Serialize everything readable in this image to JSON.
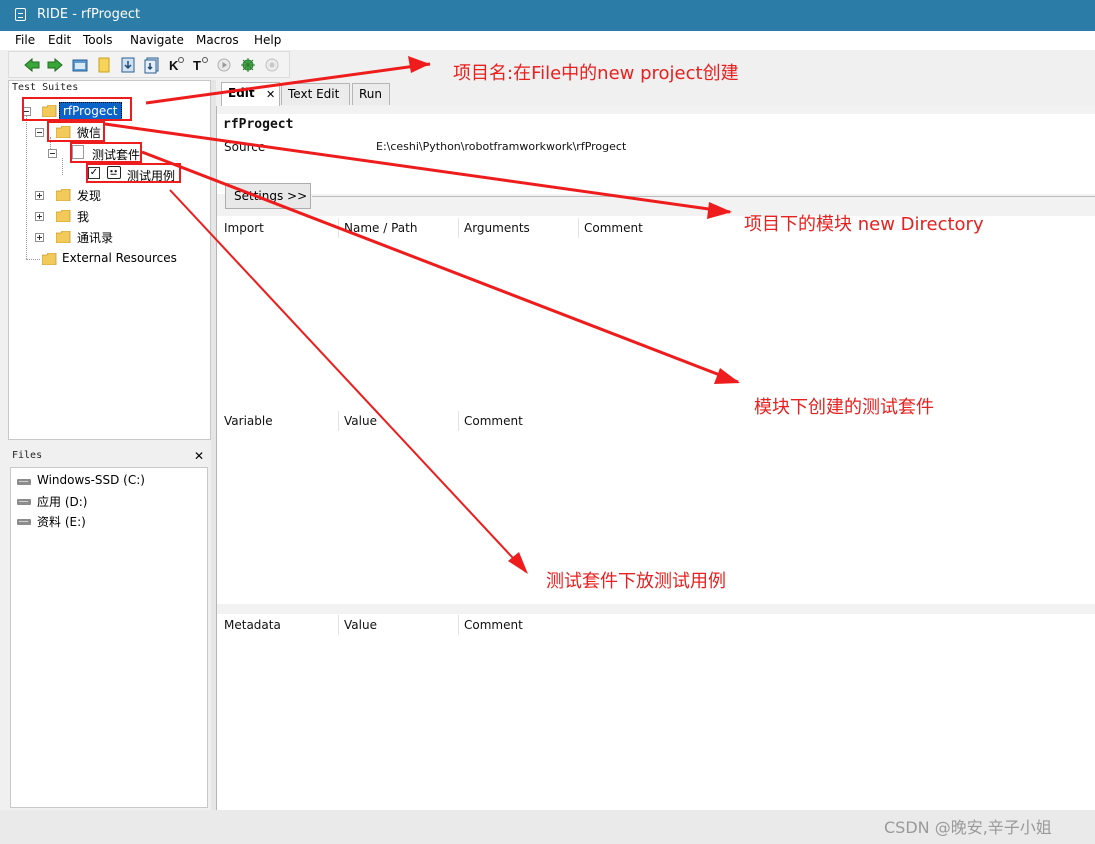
{
  "window": {
    "title": "RIDE - rfProgect"
  },
  "menu": {
    "items": [
      {
        "label": "File"
      },
      {
        "label": "Edit"
      },
      {
        "label": "Tools"
      },
      {
        "label": "Navigate"
      },
      {
        "label": "Macros"
      },
      {
        "label": "Help"
      }
    ]
  },
  "toolbar": {
    "icons": [
      "back-arrow-icon",
      "forward-arrow-icon",
      "open-folder-icon",
      "new-folder-icon",
      "save-icon",
      "save-all-icon",
      "keyword-search-icon",
      "text-search-icon",
      "run-icon",
      "debug-icon",
      "stop-icon"
    ]
  },
  "tree": {
    "panel_label": "Test Suites",
    "project": "rfProgect",
    "directory": "微信",
    "suite": "测试套件",
    "testcase": "测试用例",
    "others": [
      "发现",
      "我",
      "通讯录"
    ],
    "external": "External Resources"
  },
  "files": {
    "panel_label": "Files",
    "close_glyph": "✕",
    "drives": [
      "Windows-SSD (C:)",
      "应用 (D:)",
      "资料 (E:)"
    ]
  },
  "tabs": [
    {
      "label": "Edit",
      "close_glyph": "✕",
      "active": true
    },
    {
      "label": "Text Edit",
      "active": false
    },
    {
      "label": "Run",
      "active": false
    }
  ],
  "editor": {
    "name": "rfProgect",
    "source_label": "Source",
    "source_value": "E:\\ceshi\\Python\\robotframworkwork\\rfProgect",
    "settings_button": "Settings >>",
    "import_headers": [
      "Import",
      "Name / Path",
      "Arguments",
      "Comment"
    ],
    "variable_headers": [
      "Variable",
      "Value",
      "Comment"
    ],
    "metadata_headers": [
      "Metadata",
      "Value",
      "Comment"
    ]
  },
  "annotations": {
    "project": "项目名:在File中的new project创建",
    "directory": "项目下的模块 new Directory",
    "suite": "模块下创建的测试套件",
    "testcase": "测试套件下放测试用例",
    "color": "#e8201f"
  },
  "watermark": "CSDN @晚安,辛子小姐",
  "theme": {
    "titlebar": "#2b7ca7",
    "selection": "#0a63c9"
  }
}
